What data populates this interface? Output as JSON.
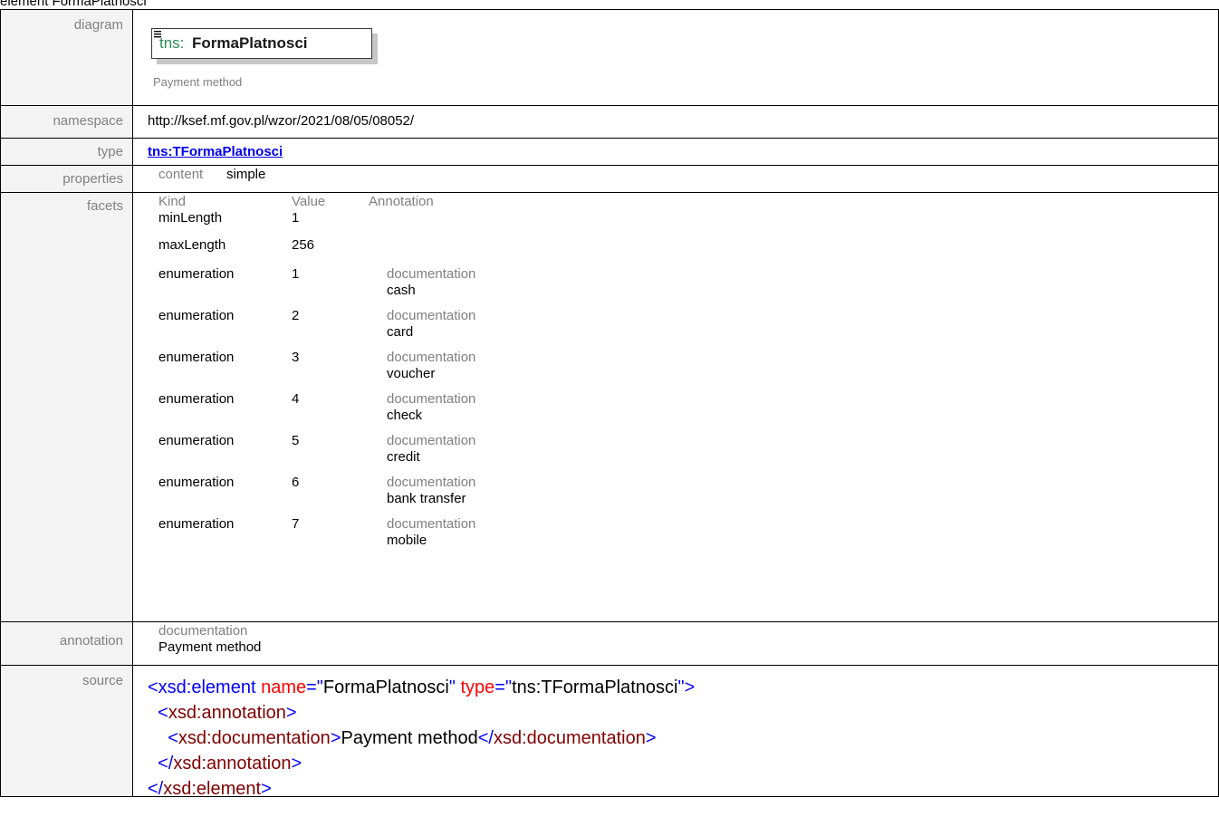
{
  "heading": "element FormaPlatnosci",
  "labels": {
    "diagram": "diagram",
    "namespace": "namespace",
    "type": "type",
    "properties": "properties",
    "facets": "facets",
    "annotation": "annotation",
    "source": "source"
  },
  "diagram": {
    "prefix": "tns:",
    "name": "FormaPlatnosci",
    "caption": "Payment method"
  },
  "namespace": "http://ksef.mf.gov.pl/wzor/2021/08/05/08052/",
  "type": "tns:TFormaPlatnosci",
  "properties": {
    "key": "content",
    "value": "simple"
  },
  "facets": {
    "headers": {
      "kind": "Kind",
      "value": "Value",
      "annotation": "Annotation"
    },
    "rows": [
      {
        "kind": "minLength",
        "value": "1",
        "doc_label": "",
        "doc": ""
      },
      {
        "kind": "maxLength",
        "value": "256",
        "doc_label": "",
        "doc": ""
      },
      {
        "kind": "enumeration",
        "value": "1",
        "doc_label": "documentation",
        "doc": "cash"
      },
      {
        "kind": "enumeration",
        "value": "2",
        "doc_label": "documentation",
        "doc": "card"
      },
      {
        "kind": "enumeration",
        "value": "3",
        "doc_label": "documentation",
        "doc": "voucher"
      },
      {
        "kind": "enumeration",
        "value": "4",
        "doc_label": "documentation",
        "doc": "check"
      },
      {
        "kind": "enumeration",
        "value": "5",
        "doc_label": "documentation",
        "doc": "credit"
      },
      {
        "kind": "enumeration",
        "value": "6",
        "doc_label": "documentation",
        "doc": "bank transfer"
      },
      {
        "kind": "enumeration",
        "value": "7",
        "doc_label": "documentation",
        "doc": "mobile"
      }
    ]
  },
  "annotation": {
    "label": "documentation",
    "text": "Payment method"
  },
  "source": {
    "l1": {
      "open": "<xsd:element",
      "attr1": " name",
      "eq1": "=\"",
      "val1": "FormaPlatnosci",
      "q1": "\"",
      "attr2": " type",
      "eq2": "=\"",
      "val2": "tns:TFormaPlatnosci",
      "close": "\">"
    },
    "l2": {
      "open": "<",
      "tag": "xsd:annotation",
      "close": ">"
    },
    "l3": {
      "open": "<",
      "tag": "xsd:documentation",
      "mid": ">",
      "text": "Payment method",
      "open2": "</",
      "tag2": "xsd:documentation",
      "close": ">"
    },
    "l4": {
      "open": "</",
      "tag": "xsd:annotation",
      "close": ">"
    },
    "l5": {
      "open": "</",
      "tag": "xsd:element",
      "close": ">"
    }
  }
}
